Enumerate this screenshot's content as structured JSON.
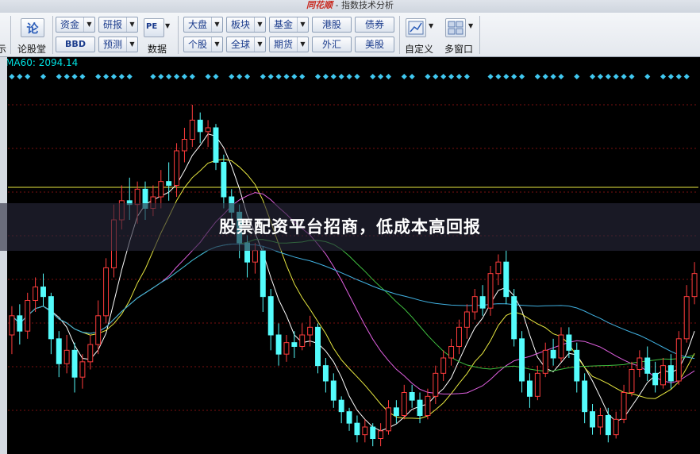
{
  "window": {
    "brand": "同花顺",
    "title_sep": " - ",
    "title": "指数技术分析"
  },
  "toolbar": {
    "partial_left_label": "示",
    "lun_icon": "论",
    "lun_label": "论股堂",
    "row1": [
      "资金",
      "研报",
      "大盘",
      "板块",
      "基金",
      "港股",
      "债券"
    ],
    "row2": [
      "BBD",
      "预测",
      "个股",
      "全球",
      "期货",
      "外汇",
      "美股"
    ],
    "pe_icon": "PE",
    "pe_label": "数据",
    "custom_label": "自定义",
    "multi_label": "多窗口"
  },
  "chart": {
    "ma_label": "MA60: 2094.14",
    "up_color": "#ff3c3c",
    "down_color": "#54fcfc",
    "ma_colors": [
      "#ffffff",
      "#e8e840",
      "#e060e0",
      "#40c040",
      "#40b0e0"
    ],
    "signal_color": "#40c8f0",
    "horizontal_line_color": "#e8e840"
  },
  "chart_data": {
    "type": "candlestick",
    "title": "",
    "candles": [
      [
        60,
        70,
        50,
        75
      ],
      [
        70,
        62,
        55,
        76
      ],
      [
        62,
        78,
        58,
        82
      ],
      [
        78,
        85,
        72,
        90
      ],
      [
        85,
        80,
        75,
        92
      ],
      [
        80,
        58,
        50,
        82
      ],
      [
        58,
        45,
        38,
        62
      ],
      [
        45,
        52,
        40,
        60
      ],
      [
        52,
        38,
        30,
        56
      ],
      [
        38,
        46,
        32,
        50
      ],
      [
        46,
        55,
        42,
        60
      ],
      [
        55,
        70,
        50,
        78
      ],
      [
        70,
        95,
        66,
        100
      ],
      [
        95,
        120,
        90,
        128
      ],
      [
        120,
        130,
        115,
        138
      ],
      [
        130,
        128,
        120,
        142
      ],
      [
        128,
        136,
        118,
        140
      ],
      [
        136,
        126,
        120,
        140
      ],
      [
        126,
        132,
        122,
        138
      ],
      [
        132,
        140,
        126,
        146
      ],
      [
        140,
        138,
        130,
        150
      ],
      [
        138,
        156,
        132,
        160
      ],
      [
        156,
        162,
        150,
        168
      ],
      [
        162,
        172,
        158,
        180
      ],
      [
        172,
        166,
        160,
        176
      ],
      [
        166,
        168,
        158,
        172
      ],
      [
        168,
        150,
        146,
        170
      ],
      [
        150,
        132,
        126,
        154
      ],
      [
        132,
        124,
        116,
        136
      ],
      [
        124,
        108,
        100,
        128
      ],
      [
        108,
        98,
        90,
        112
      ],
      [
        98,
        104,
        92,
        108
      ],
      [
        104,
        80,
        72,
        106
      ],
      [
        80,
        60,
        52,
        84
      ],
      [
        60,
        50,
        44,
        66
      ],
      [
        50,
        56,
        46,
        60
      ],
      [
        56,
        54,
        48,
        62
      ],
      [
        54,
        60,
        52,
        66
      ],
      [
        60,
        64,
        54,
        70
      ],
      [
        64,
        44,
        40,
        66
      ],
      [
        44,
        36,
        30,
        48
      ],
      [
        36,
        26,
        22,
        40
      ],
      [
        26,
        20,
        14,
        28
      ],
      [
        20,
        14,
        10,
        22
      ],
      [
        14,
        8,
        4,
        18
      ],
      [
        8,
        12,
        4,
        16
      ],
      [
        12,
        6,
        2,
        14
      ],
      [
        6,
        10,
        2,
        14
      ],
      [
        10,
        22,
        8,
        26
      ],
      [
        22,
        18,
        14,
        26
      ],
      [
        18,
        30,
        16,
        34
      ],
      [
        30,
        26,
        22,
        34
      ],
      [
        26,
        18,
        14,
        30
      ],
      [
        18,
        28,
        16,
        32
      ],
      [
        28,
        40,
        24,
        44
      ],
      [
        40,
        48,
        36,
        52
      ],
      [
        48,
        54,
        44,
        58
      ],
      [
        54,
        64,
        50,
        68
      ],
      [
        64,
        72,
        58,
        76
      ],
      [
        72,
        80,
        68,
        84
      ],
      [
        80,
        74,
        70,
        86
      ],
      [
        74,
        92,
        70,
        96
      ],
      [
        92,
        98,
        86,
        102
      ],
      [
        98,
        80,
        76,
        104
      ],
      [
        80,
        58,
        54,
        84
      ],
      [
        58,
        36,
        30,
        62
      ],
      [
        36,
        28,
        22,
        40
      ],
      [
        28,
        40,
        26,
        44
      ],
      [
        40,
        52,
        38,
        56
      ],
      [
        52,
        48,
        44,
        58
      ],
      [
        48,
        60,
        46,
        64
      ],
      [
        60,
        52,
        48,
        64
      ],
      [
        52,
        36,
        30,
        56
      ],
      [
        36,
        20,
        14,
        40
      ],
      [
        20,
        12,
        8,
        24
      ],
      [
        12,
        18,
        8,
        22
      ],
      [
        18,
        8,
        4,
        22
      ],
      [
        8,
        16,
        6,
        20
      ],
      [
        16,
        30,
        14,
        34
      ],
      [
        30,
        42,
        28,
        46
      ],
      [
        42,
        48,
        38,
        52
      ],
      [
        48,
        40,
        36,
        54
      ],
      [
        40,
        34,
        30,
        46
      ],
      [
        34,
        44,
        32,
        48
      ],
      [
        44,
        36,
        32,
        50
      ],
      [
        36,
        58,
        34,
        62
      ],
      [
        58,
        80,
        56,
        86
      ],
      [
        80,
        92,
        76,
        98
      ]
    ],
    "ylim": [
      0,
      180
    ]
  }
}
